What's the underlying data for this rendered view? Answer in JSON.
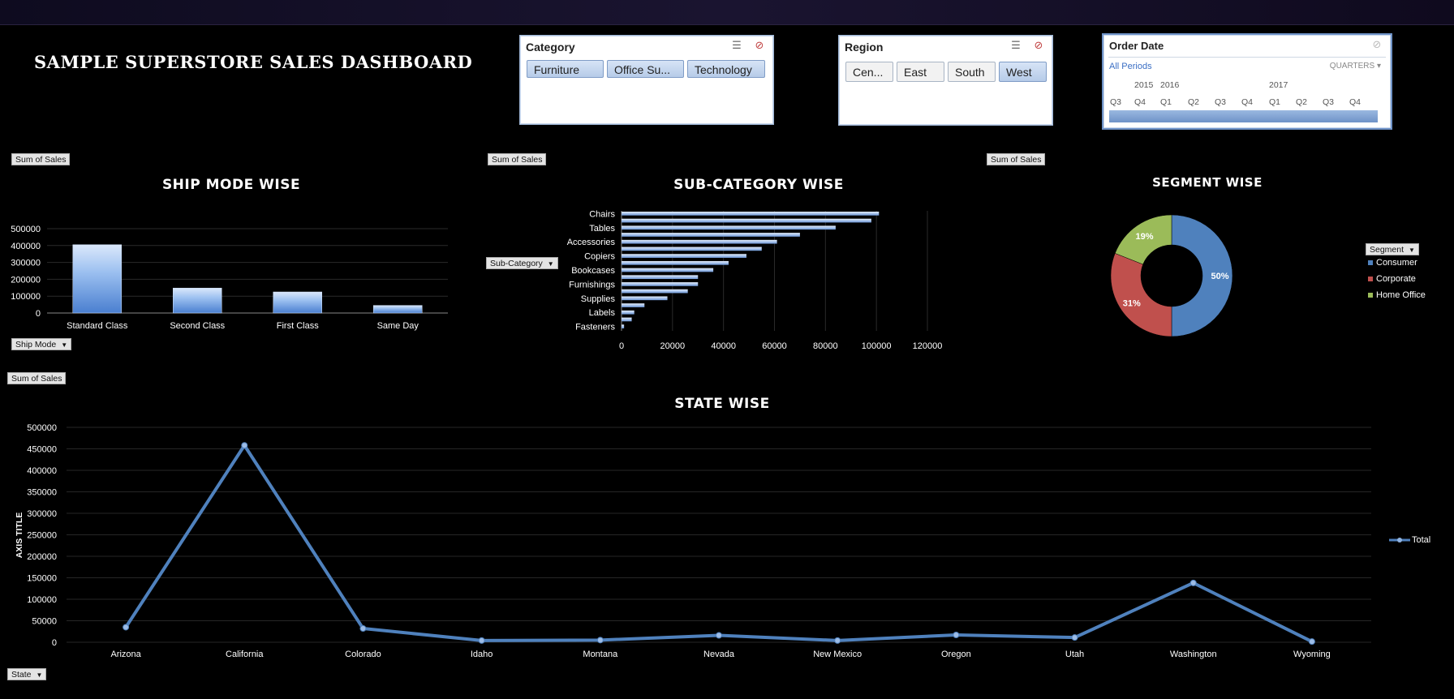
{
  "dashboard": {
    "title": "SAMPLE SUPERSTORE SALES DASHBOARD"
  },
  "slicers": {
    "category": {
      "header": "Category",
      "items": [
        "Furniture",
        "Office Su...",
        "Technology"
      ],
      "selected": [
        "Furniture",
        "Office Su...",
        "Technology"
      ]
    },
    "region": {
      "header": "Region",
      "items": [
        "Cen...",
        "East",
        "South",
        "West"
      ],
      "selected": [
        "West"
      ]
    },
    "order_date": {
      "header": "Order Date",
      "all_periods": "All Periods",
      "level": "QUARTERS",
      "years": [
        "2015",
        "2016",
        "2017"
      ],
      "quarters": [
        "Q3",
        "Q4",
        "Q1",
        "Q2",
        "Q3",
        "Q4",
        "Q1",
        "Q2",
        "Q3",
        "Q4"
      ]
    }
  },
  "field_buttons": {
    "sum_of_sales": "Sum of Sales",
    "ship_mode": "Ship Mode",
    "sub_category": "Sub-Category",
    "segment": "Segment",
    "state": "State"
  },
  "colors": {
    "bar": "#9cc0f0",
    "line": "#4f81bd",
    "consumer": "#4f81bd",
    "corporate": "#c0504d",
    "home_office": "#9bbb59"
  },
  "chart_data": [
    {
      "id": "ship_mode",
      "type": "bar",
      "title": "SHIP MODE WISE",
      "categories": [
        "Standard Class",
        "Second Class",
        "First Class",
        "Same Day"
      ],
      "values": [
        405000,
        148000,
        125000,
        45000
      ],
      "ylim": [
        0,
        500000
      ],
      "yticks": [
        "0",
        "100000",
        "200000",
        "300000",
        "400000",
        "500000"
      ]
    },
    {
      "id": "sub_category",
      "type": "bar",
      "orientation": "horizontal",
      "title": "SUB-CATEGORY WISE",
      "category_labels": [
        "Chairs",
        "Tables",
        "Accessories",
        "Copiers",
        "Bookcases",
        "Furnishings",
        "Supplies",
        "Labels",
        "Fasteners"
      ],
      "values": [
        101000,
        98000,
        84000,
        70000,
        61000,
        55000,
        49000,
        42000,
        36000,
        30000,
        30000,
        26000,
        18000,
        9000,
        5000,
        4000,
        1000
      ],
      "xlim": [
        0,
        120000
      ],
      "xticks": [
        "0",
        "20000",
        "40000",
        "60000",
        "80000",
        "100000",
        "120000"
      ]
    },
    {
      "id": "segment",
      "type": "pie",
      "title": "SEGMENT WISE",
      "slices": [
        {
          "label": "Consumer",
          "value": 50,
          "text": "50%"
        },
        {
          "label": "Corporate",
          "value": 31,
          "text": "31%"
        },
        {
          "label": "Home Office",
          "value": 19,
          "text": "19%"
        }
      ],
      "legend": [
        "Consumer",
        "Corporate",
        "Home Office"
      ]
    },
    {
      "id": "state",
      "type": "line",
      "title": "STATE WISE",
      "ylabel": "AXIS TITLE",
      "series": [
        {
          "name": "Total"
        }
      ],
      "categories": [
        "Arizona",
        "California",
        "Colorado",
        "Idaho",
        "Montana",
        "Nevada",
        "New Mexico",
        "Oregon",
        "Utah",
        "Washington",
        "Wyoming"
      ],
      "values": [
        35000,
        458000,
        32000,
        4000,
        5000,
        16000,
        4000,
        17000,
        11000,
        138000,
        1600
      ],
      "ylim": [
        0,
        500000
      ],
      "yticks": [
        "0",
        "50000",
        "100000",
        "150000",
        "200000",
        "250000",
        "300000",
        "350000",
        "400000",
        "450000",
        "500000"
      ]
    }
  ]
}
